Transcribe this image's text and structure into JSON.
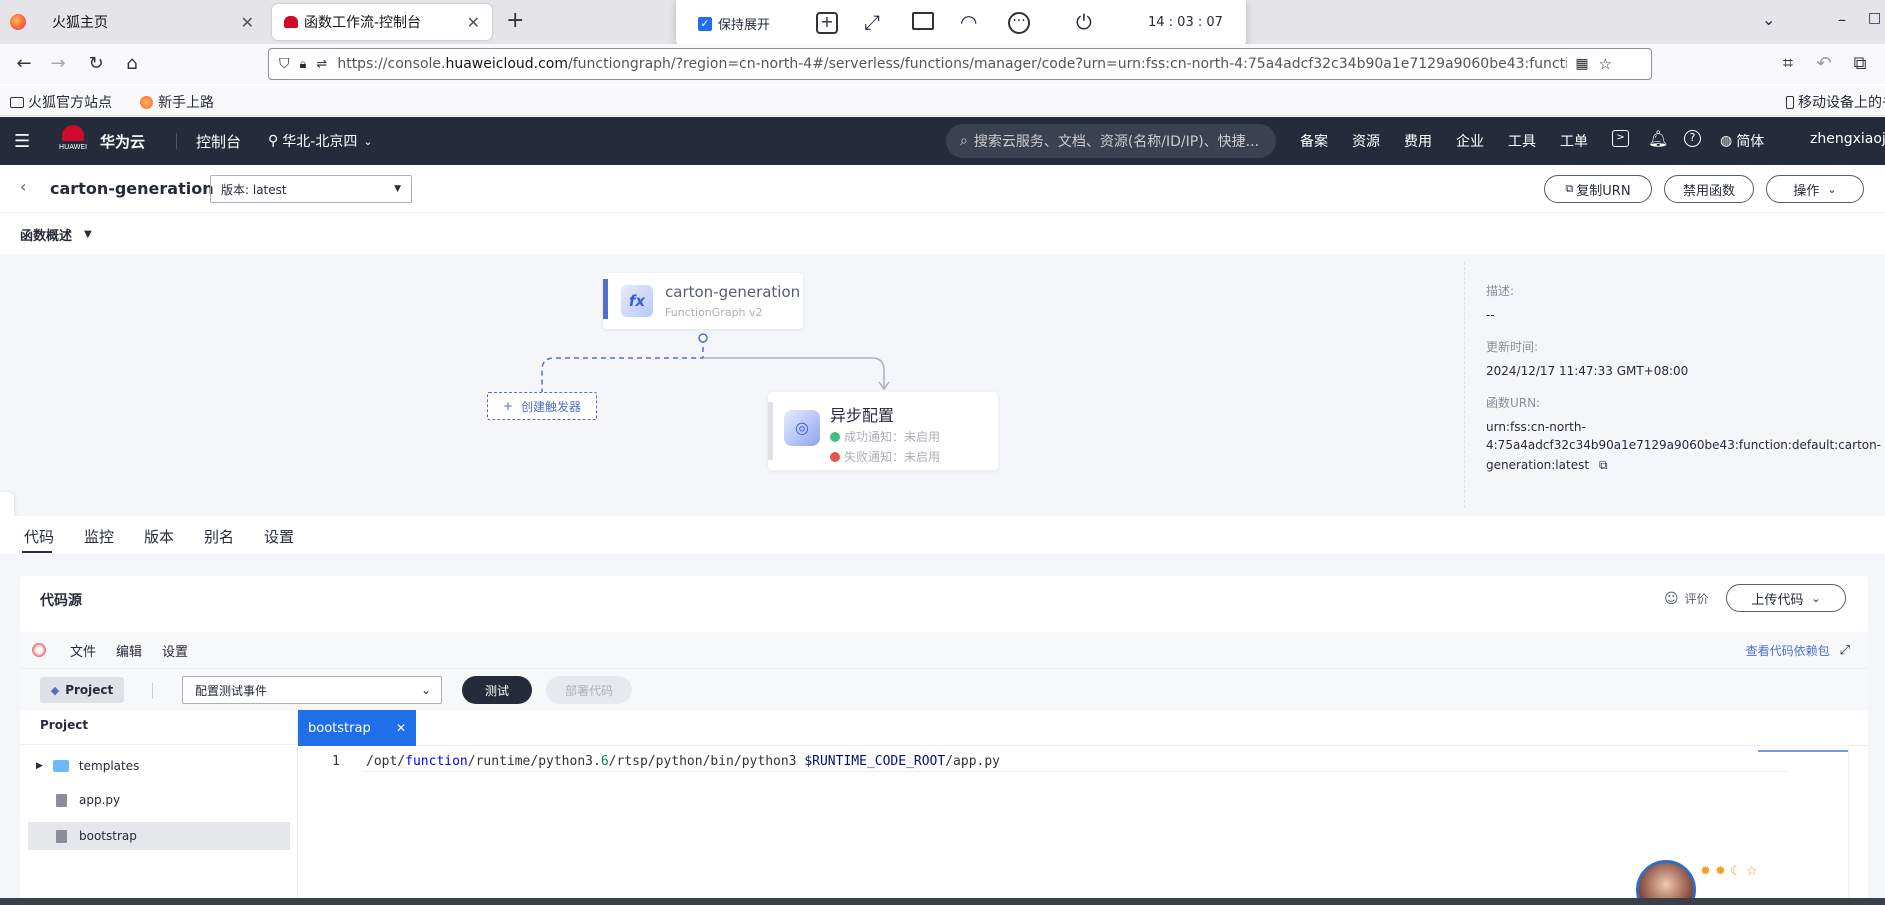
{
  "browser": {
    "tabs": [
      {
        "title": "火狐主页",
        "active": false
      },
      {
        "title": "函数工作流-控制台",
        "active": true
      }
    ],
    "new_tab": "+",
    "url_prefix": "https://console.",
    "url_domain": "huaweicloud.com",
    "url_rest": "/functiongraph/?region=cn-north-4#/serverless/functions/manager/code?urn=urn:fss:cn-north-4:75a4adcf32c34b90a1e7129a9060be43:function:default:cart",
    "bookmarks": [
      "火狐官方站点",
      "新手上路"
    ],
    "mobile_bookmarks": "移动设备上的书签"
  },
  "popbar": {
    "keep_expanded": "保持展开",
    "clock": "14 : 03 : 07"
  },
  "header": {
    "brand_logo_text": "HUAWEI",
    "brand": "华为云",
    "console": "控制台",
    "region": "华北-北京四",
    "search_placeholder": "搜索云服务、文档、资源(名称/ID/IP)、快捷...",
    "menu": [
      "备案",
      "资源",
      "费用",
      "企业",
      "工具",
      "工单"
    ],
    "language": "简体",
    "user": "zhengxiaojia"
  },
  "function": {
    "name": "carton-generation",
    "version_label": "版本: latest",
    "copy_urn": "复制URN",
    "disable": "禁用函数",
    "actions": "操作"
  },
  "overview": {
    "title": "函数概述",
    "node_name": "carton-generation",
    "node_sub": "FunctionGraph v2",
    "create_trigger": "创建触发器",
    "async_title": "异步配置",
    "success_notify": "成功通知：未启用",
    "failure_notify": "失败通知：未启用",
    "colors": {
      "success": "#3fbf7f",
      "failure": "#e5534b",
      "accent": "#526ecc"
    }
  },
  "details": {
    "desc_label": "描述:",
    "desc_value": "--",
    "updated_label": "更新时间:",
    "updated_value": "2024/12/17 11:47:33 GMT+08:00",
    "urn_label": "函数URN:",
    "urn_line1": "urn:fss:cn-north-",
    "urn_line2": "4:75a4adcf32c34b90a1e7129a9060be43:function:default:carton-",
    "urn_line3": "generation:latest"
  },
  "tabs": [
    "代码",
    "监控",
    "版本",
    "别名",
    "设置"
  ],
  "code": {
    "section_title": "代码源",
    "rate": "评价",
    "upload": "上传代码",
    "menu": [
      "文件",
      "编辑",
      "设置"
    ],
    "view_deps": "查看代码依赖包",
    "project_btn": "Project",
    "test_event": "配置测试事件",
    "test": "测试",
    "deploy": "部署代码",
    "tree_title": "Project",
    "files": [
      "templates",
      "app.py",
      "bootstrap"
    ],
    "editor_tab": "bootstrap",
    "line_no": "1",
    "code_seg1": "/opt/",
    "code_kw": "function",
    "code_seg2": "/runtime/python3.",
    "code_num": "6",
    "code_seg3": "/rtsp/python/bin/python3 ",
    "code_var": "$RUNTIME_CODE_ROOT",
    "code_seg4": "/app.py"
  }
}
